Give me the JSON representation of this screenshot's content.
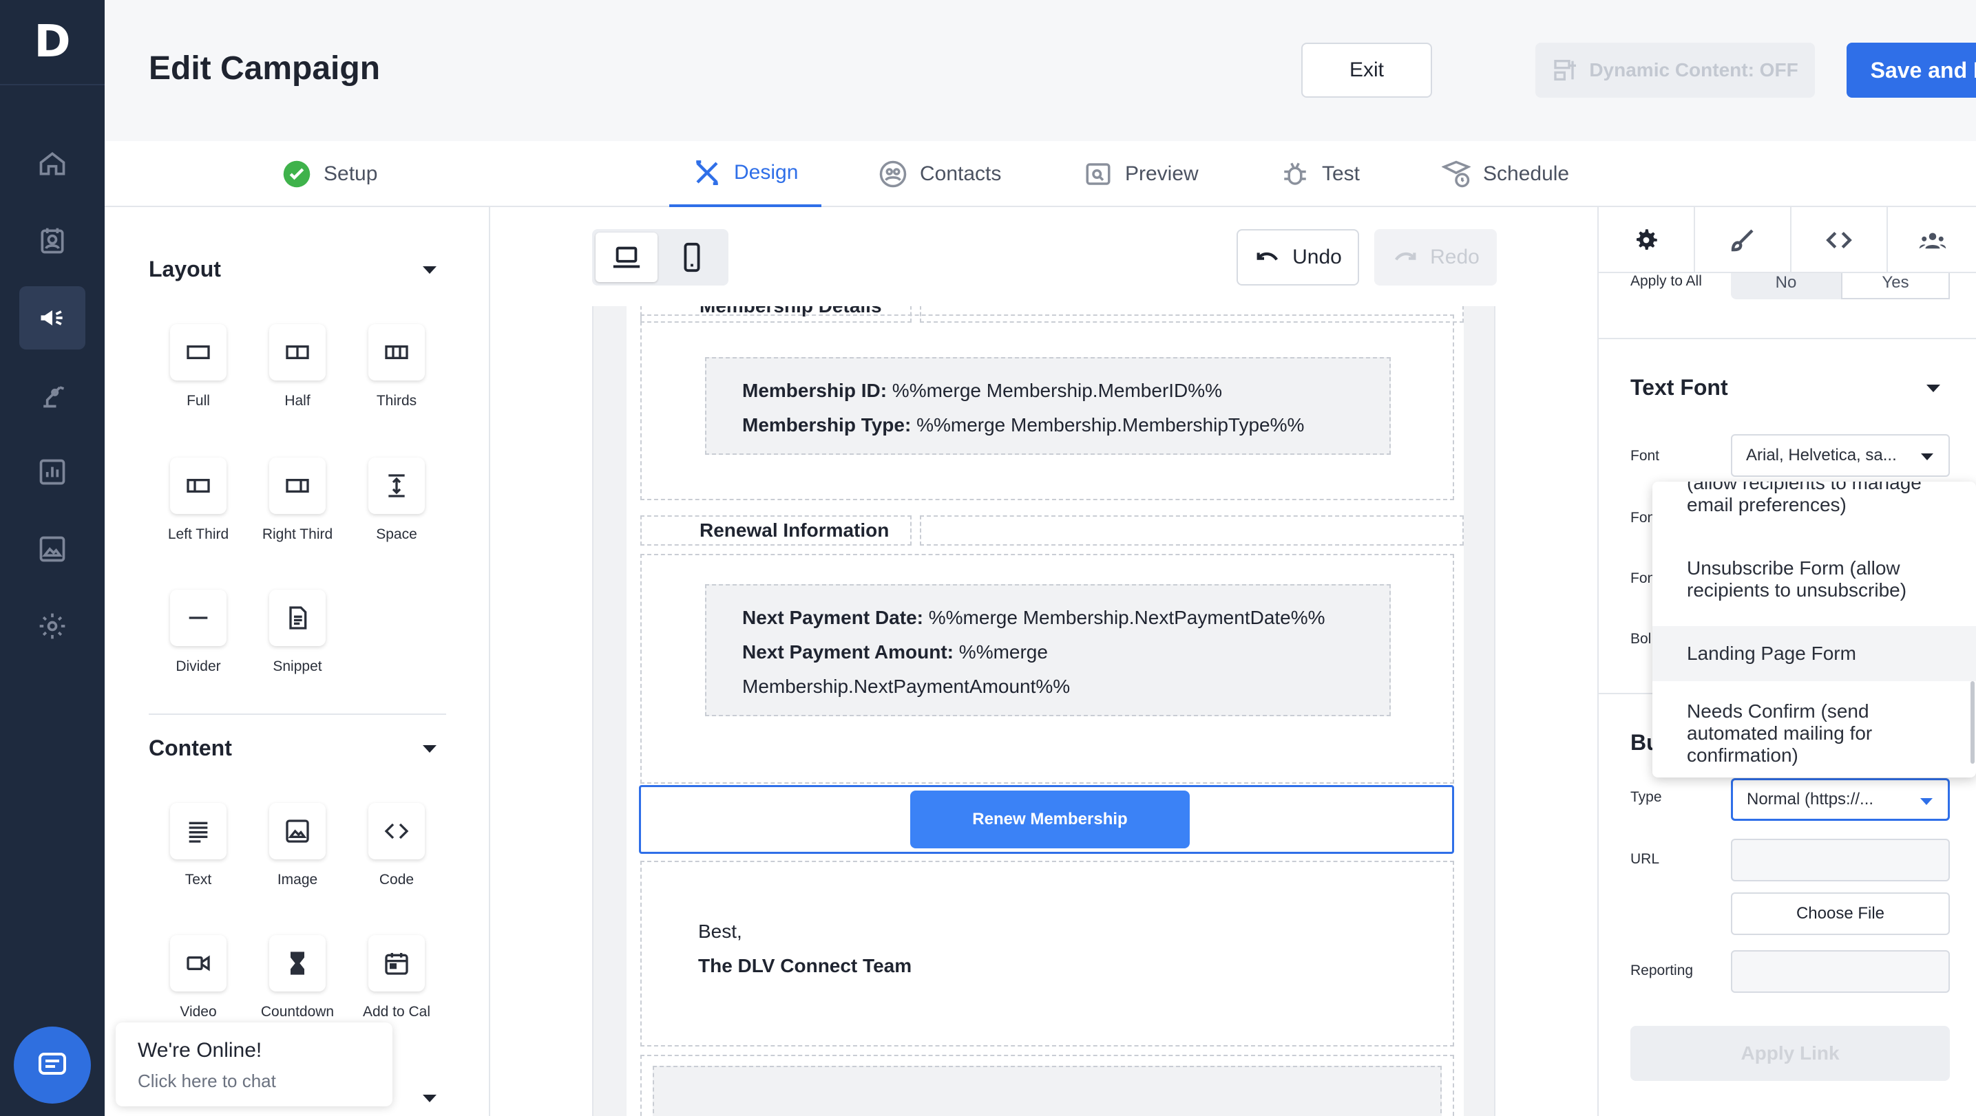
{
  "app": {
    "logo": "D"
  },
  "header": {
    "title": "Edit Campaign",
    "exit_label": "Exit",
    "dynamic_label": "Dynamic Content: OFF",
    "save_label": "Save and Next"
  },
  "steps": [
    {
      "label": "Setup"
    },
    {
      "label": "Design"
    },
    {
      "label": "Contacts"
    },
    {
      "label": "Preview"
    },
    {
      "label": "Test"
    },
    {
      "label": "Schedule"
    }
  ],
  "layout": {
    "title": "Layout",
    "tiles": [
      "Full",
      "Half",
      "Thirds",
      "Left Third",
      "Right Third",
      "Space",
      "Divider",
      "Snippet"
    ]
  },
  "content": {
    "title": "Content",
    "tiles": [
      "Text",
      "Image",
      "Code",
      "Video",
      "Countdown",
      "Add to Cal"
    ]
  },
  "chat": {
    "title": "We're Online!",
    "subtitle": "Click here to chat"
  },
  "toolbar": {
    "undo_label": "Undo",
    "redo_label": "Redo"
  },
  "email": {
    "membership_header": "Membership Details",
    "membership_id_label": "Membership ID:",
    "membership_id_value": " %%merge Membership.MemberID%%",
    "membership_type_label": "Membership Type:",
    "membership_type_value": " %%merge Membership.MembershipType%%",
    "renewal_header": "Renewal Information",
    "next_date_label": "Next Payment Date:",
    "next_date_value": " %%merge Membership.NextPaymentDate%%",
    "next_amount_label": "Next Payment Amount:",
    "next_amount_value": " %%merge",
    "next_amount_value2": "Membership.NextPaymentAmount%%",
    "button_label": "Renew Membership",
    "sign_line1": "Best,",
    "sign_line2": "The DLV Connect Team"
  },
  "right": {
    "apply_to_all": "Apply to All",
    "opt_no": "No",
    "opt_yes": "Yes",
    "text_font_title": "Text Font",
    "font_label": "Font",
    "font_value": "Arial, Helvetica, sa...",
    "hidden_label_1": "Fon",
    "hidden_label_2": "Fon",
    "hidden_label_3": "Bol",
    "button_section": "Bu",
    "type_label": "Type",
    "type_value": "Normal (https://...",
    "url_label": "URL",
    "choose_file": "Choose File",
    "reporting_label": "Reporting",
    "apply_link": "Apply Link"
  },
  "dropdown": {
    "items": [
      "(allow recipients to manage email preferences)",
      "Unsubscribe Form (allow recipients to unsubscribe)",
      "Landing Page Form",
      "Needs Confirm (send automated mailing for confirmation)"
    ]
  }
}
